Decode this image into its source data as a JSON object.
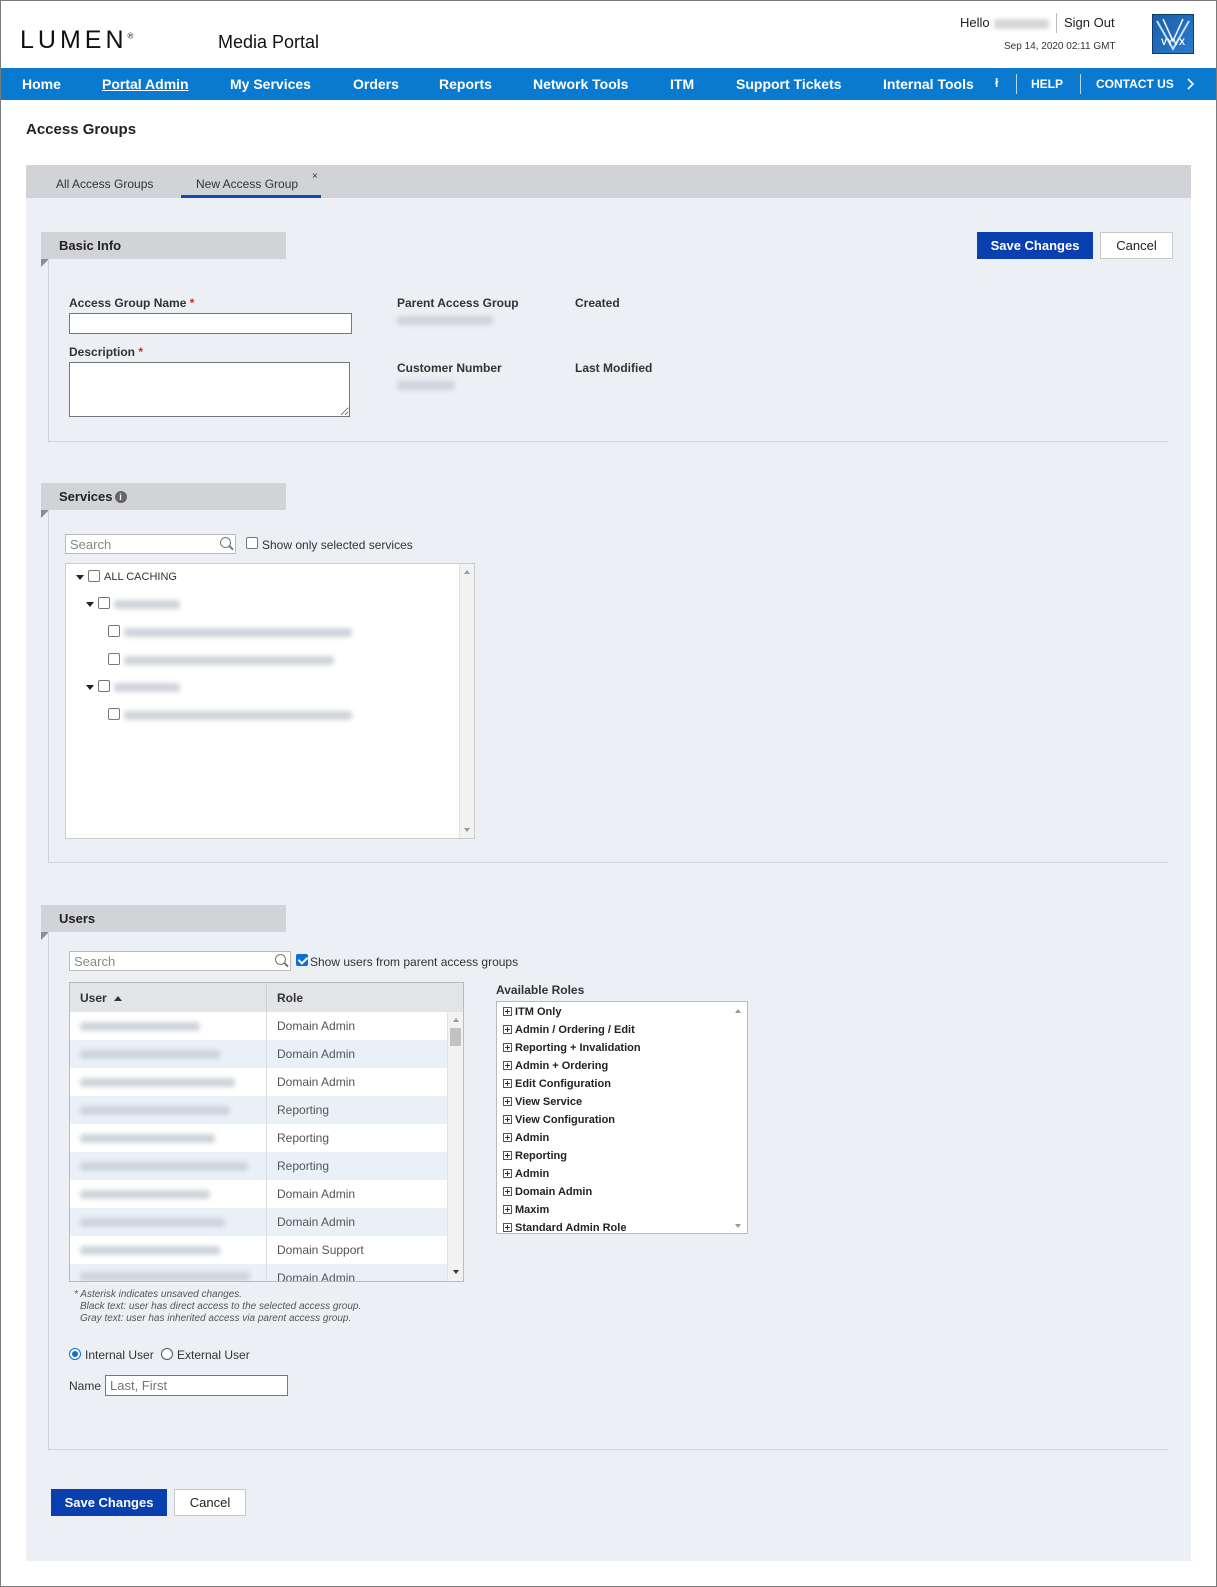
{
  "header": {
    "logo": "LUMEN",
    "logo_mark": "®",
    "portal_title": "Media Portal",
    "hello": "Hello",
    "sign_out": "Sign Out",
    "datetime": "Sep 14, 2020 02:11 GMT",
    "brand_badge": "VYVX"
  },
  "nav": {
    "items": [
      "Home",
      "Portal Admin",
      "My Services",
      "Orders",
      "Reports",
      "Network Tools",
      "ITM",
      "Support Tickets",
      "Internal Tools"
    ],
    "help": "HELP",
    "contact": "CONTACT US",
    "more_icon": "chevron-right-icon",
    "color": "#0a7ad1"
  },
  "page": {
    "title": "Access Groups"
  },
  "tabs": [
    {
      "label": "All Access Groups",
      "active": false
    },
    {
      "label": "New Access Group",
      "active": true,
      "close": "×"
    }
  ],
  "basic_info": {
    "header": "Basic Info",
    "save": "Save Changes",
    "cancel": "Cancel",
    "name_label": "Access Group Name",
    "description_label": "Description",
    "required_mark": "*",
    "name_value": "",
    "description_value": "",
    "parent_label": "Parent Access Group",
    "created_label": "Created",
    "customer_label": "Customer Number",
    "modified_label": "Last Modified"
  },
  "services": {
    "header": "Services",
    "search_placeholder": "Search",
    "show_selected": "Show only selected services",
    "tree_root": "ALL CACHING"
  },
  "users": {
    "header": "Users",
    "search_placeholder": "Search",
    "show_parent": "Show users from parent access groups",
    "show_parent_checked": true,
    "col_user": "User",
    "col_role": "Role",
    "roles": [
      "Domain Admin",
      "Domain Admin",
      "Domain Admin",
      "Reporting",
      "Reporting",
      "Reporting",
      "Domain Admin",
      "Domain Admin",
      "Domain Support",
      "Domain Admin"
    ],
    "available_roles_label": "Available Roles",
    "available_roles": [
      "ITM Only",
      "Admin / Ordering / Edit",
      "Reporting + Invalidation",
      "Admin + Ordering",
      "Edit Configuration",
      "View Service",
      "View Configuration",
      "Admin",
      "Reporting",
      "Admin",
      "Domain Admin",
      "Maxim",
      "Standard Admin Role"
    ],
    "note1": "* Asterisk indicates unsaved changes.",
    "note2": "Black text: user has direct access to the selected access group.",
    "note3": "Gray text: user has inherited access via parent access group.",
    "internal_label": "Internal User",
    "external_label": "External User",
    "name_label": "Name",
    "name_placeholder": "Last, First"
  },
  "footer": {
    "save": "Save Changes",
    "cancel": "Cancel"
  }
}
